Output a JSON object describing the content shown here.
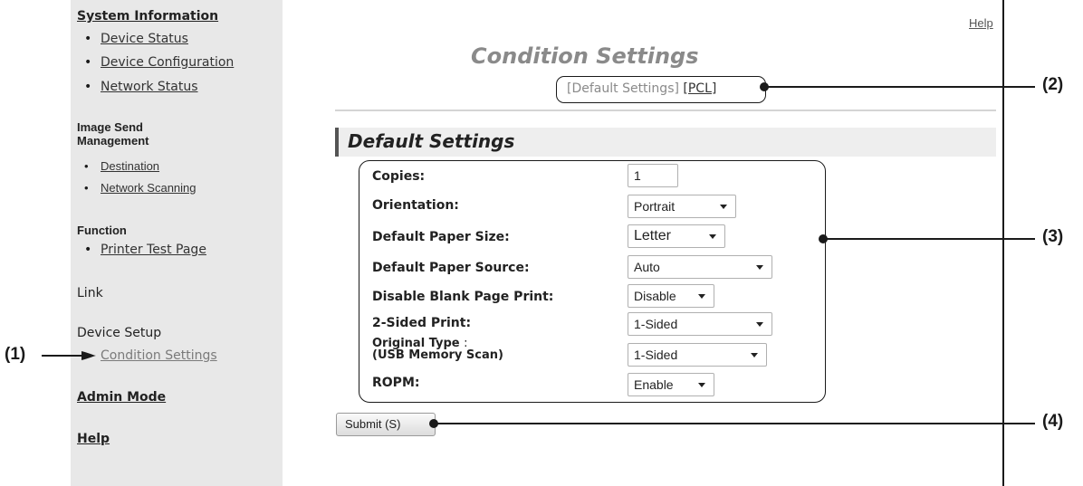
{
  "sidebar": {
    "system_information": "System Information",
    "system_items": [
      "Device Status",
      "Device Configuration",
      "Network Status"
    ],
    "image_send_management_line1": "Image Send",
    "image_send_management_line2": "Management",
    "image_send_items": [
      "Destination",
      "Network Scanning"
    ],
    "function": "Function",
    "function_items": [
      "Printer Test Page"
    ],
    "link": "Link",
    "device_setup": "Device Setup",
    "device_setup_items": [
      "Condition Settings"
    ],
    "admin_mode": "Admin Mode",
    "help": "Help"
  },
  "header": {
    "help_link": "Help",
    "page_title": "Condition Settings",
    "subnav_default": "[Default Settings] ",
    "subnav_pcl": "[PCL]"
  },
  "section": {
    "title": "Default Settings"
  },
  "settings": [
    {
      "label": "Copies:",
      "value": "1",
      "type": "text"
    },
    {
      "label": "Orientation:",
      "value": "Portrait",
      "type": "select"
    },
    {
      "label": "Default Paper Size:",
      "value": "Letter",
      "type": "select"
    },
    {
      "label": "Default Paper Source:",
      "value": "Auto",
      "type": "select"
    },
    {
      "label": "Disable Blank Page Print:",
      "value": "Disable",
      "type": "select"
    },
    {
      "label": "2-Sided Print:",
      "value": "1-Sided",
      "type": "select"
    },
    {
      "label_line1": "Original Type",
      "label_colon": ":",
      "label_line2": "(USB Memory Scan)",
      "value": "1-Sided",
      "type": "select"
    },
    {
      "label": "ROPM:",
      "value": "Enable",
      "type": "select"
    }
  ],
  "submit_label": "Submit (S)",
  "callouts": [
    "(1)",
    "(2)",
    "(3)",
    "(4)"
  ],
  "colors": {
    "sidebar_bg": "#e8e8e8",
    "title_gray": "#8a8a8a",
    "section_bar": "#eeeeee"
  }
}
